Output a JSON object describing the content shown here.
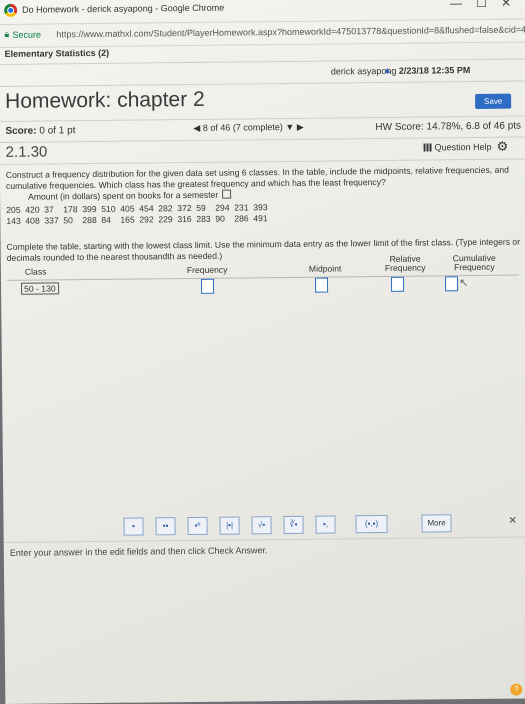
{
  "window": {
    "title": "Do Homework - derick asyapong - Google Chrome",
    "minimize": "—",
    "restore": "☐",
    "close": "✕"
  },
  "address": {
    "secure_label": "Secure",
    "url": "https://www.mathxl.com/Student/PlayerHomework.aspx?homeworkId=475013778&questionId=8&flushed=false&cid=4916044&centerwin=yes"
  },
  "course": {
    "name": "Elementary Statistics (2)"
  },
  "user": {
    "name": "derick asyapong",
    "datetime": "2/23/18 12:35 PM"
  },
  "homework": {
    "title": "Homework: chapter 2",
    "save_label": "Save",
    "score_label": "Score:",
    "score_value": "0 of 1 pt",
    "nav_text": "8 of 46 (7 complete)",
    "hw_score": "HW Score: 14.78%, 6.8 of 46 pts"
  },
  "question": {
    "number": "2.1.30",
    "help_label": "Question Help",
    "prompt": "Construct a frequency distribution for the given data set using 6 classes. In the table, include the midpoints, relative frequencies, and cumulative frequencies. Which class has the greatest frequency and which has the least frequency?",
    "data_title": "Amount (in dollars) spent on books for a semester",
    "data_rows": [
      [
        "205",
        "420",
        "37",
        "178",
        "399",
        "510",
        "405",
        "454",
        "282",
        "372",
        "59",
        "294",
        "231",
        "393"
      ],
      [
        "143",
        "408",
        "337",
        "50",
        "288",
        "84",
        "165",
        "292",
        "229",
        "316",
        "283",
        "90",
        "286",
        "491"
      ]
    ],
    "instructions": "Complete the table, starting with the lowest class limit. Use the minimum data entry as the lower limit of the first class. (Type integers or decimals rounded to the nearest thousandth as needed.)",
    "table": {
      "headers": {
        "class": "Class",
        "frequency": "Frequency",
        "midpoint": "Midpoint",
        "relative_1": "Relative",
        "relative_2": "Frequency",
        "cumulative_1": "Cumulative",
        "cumulative_2": "Frequency"
      },
      "first_row_class": "50 - 130"
    }
  },
  "toolbar": {
    "buttons": [
      "▪",
      "▪▪",
      "▪ʰ",
      "|▪|",
      "√▪",
      "∛▪",
      "▪,",
      "(▪,▪)"
    ],
    "more_label": "More"
  },
  "footer": {
    "instruction": "Enter your answer in the edit fields and then click Check Answer."
  }
}
